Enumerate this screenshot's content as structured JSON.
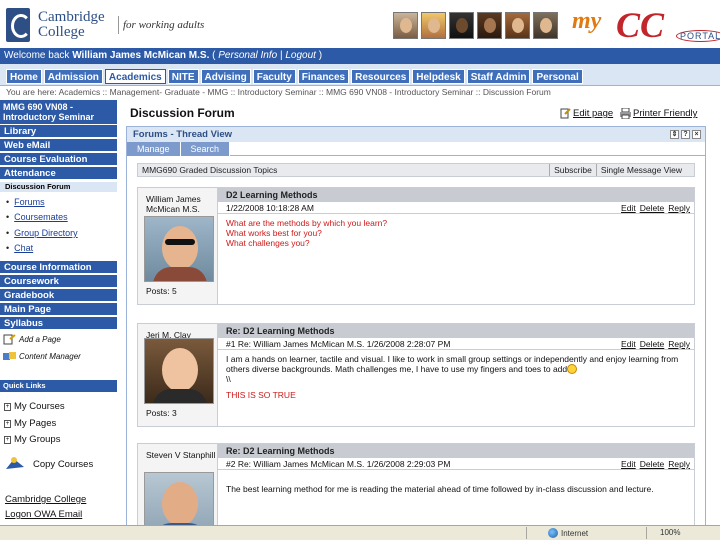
{
  "header": {
    "college_name": "Cambridge College",
    "tagline": "for working adults",
    "portal_my": "my",
    "portal_cc": "CC",
    "portal_label": "PORTAL"
  },
  "welcome": {
    "prefix": "Welcome back ",
    "user": "William James McMican M.S.",
    "personal_info": "Personal Info",
    "separator": "|",
    "logout": "Logout"
  },
  "nav": {
    "tabs": [
      "Home",
      "Admission",
      "Academics",
      "NITE",
      "Advising",
      "Faculty",
      "Finances",
      "Resources",
      "Helpdesk",
      "Staff Admin",
      "Personal"
    ],
    "active": "Academics"
  },
  "breadcrumb": "You are here: Academics :: Management- Graduate - MMG :: Introductory Seminar :: MMG 690 VN08 - Introductory Seminar :: Discussion Forum",
  "sidebar": {
    "course_title": "MMG 690 VN08 - Introductory Seminar",
    "items": [
      "Library",
      "Web eMail",
      "Course Evaluation",
      "Attendance"
    ],
    "forum_label": "Discussion Forum",
    "sub_links": [
      "Forums",
      "Coursemates",
      "Group Directory",
      "Chat"
    ],
    "items2": [
      "Course Information",
      "Coursework",
      "Gradebook",
      "Main Page",
      "Syllabus"
    ],
    "tools": [
      "Add a Page",
      "Content Manager"
    ],
    "quick_links_label": "Quick Links",
    "quick_links": [
      "My Courses",
      "My Pages",
      "My Groups"
    ],
    "copy_courses": "Copy Courses",
    "external_links": [
      "Cambridge College",
      "Logon OWA Email"
    ]
  },
  "main": {
    "title": "Discussion Forum",
    "edit_page": "Edit page",
    "printer_friendly": "Printer Friendly",
    "panel_title": "Forums - Thread View",
    "subtabs": [
      "Manage",
      "Search"
    ],
    "forum_name": "MMG690 Graded Discussion Topics",
    "subscribe": "Subscribe",
    "single_view": "Single Message View"
  },
  "posts": [
    {
      "author": "William James McMican M.S.",
      "posts_label": "Posts:",
      "post_count": "5",
      "title": "D2 Learning Methods",
      "meta": "1/22/2008 10:18:28 AM",
      "actions": [
        "Edit",
        "Delete",
        "Reply"
      ],
      "lines": [
        "What are the methods by which you learn?",
        "What works best for you?",
        "What challenges you?"
      ]
    },
    {
      "author": "Jeri M. Clay",
      "posts_label": "Posts:",
      "post_count": "3",
      "title": "Re: D2 Learning Methods",
      "meta": "#1 Re: William James McMican M.S. 1/26/2008 2:28:07 PM",
      "actions": [
        "Edit",
        "Delete",
        "Reply"
      ],
      "body": "I am a hands on learner, tactile and visual. I like to work in small group settings or independently and enjoy learning from others diverse backgrounds. Math challenges me, I have to use my fingers and toes to add",
      "tail": "\\\\",
      "emphasis": "THIS IS SO TRUE"
    },
    {
      "author": "Steven V Stanphill",
      "title": "Re: D2 Learning Methods",
      "meta": "#2 Re: William James McMican M.S. 1/26/2008 2:29:03 PM",
      "actions": [
        "Edit",
        "Delete",
        "Reply"
      ],
      "body": "The best learning method for me is reading the material ahead of time followed by in-class discussion and lecture."
    }
  ],
  "statusbar": {
    "zone": "Internet",
    "zoom": "100%"
  },
  "colors": {
    "primary_blue": "#2d5aa6",
    "light_blue": "#dbe6f4",
    "accent_orange": "#e07a12",
    "accent_red": "#c2262b",
    "link_red": "#cc1a1a"
  }
}
